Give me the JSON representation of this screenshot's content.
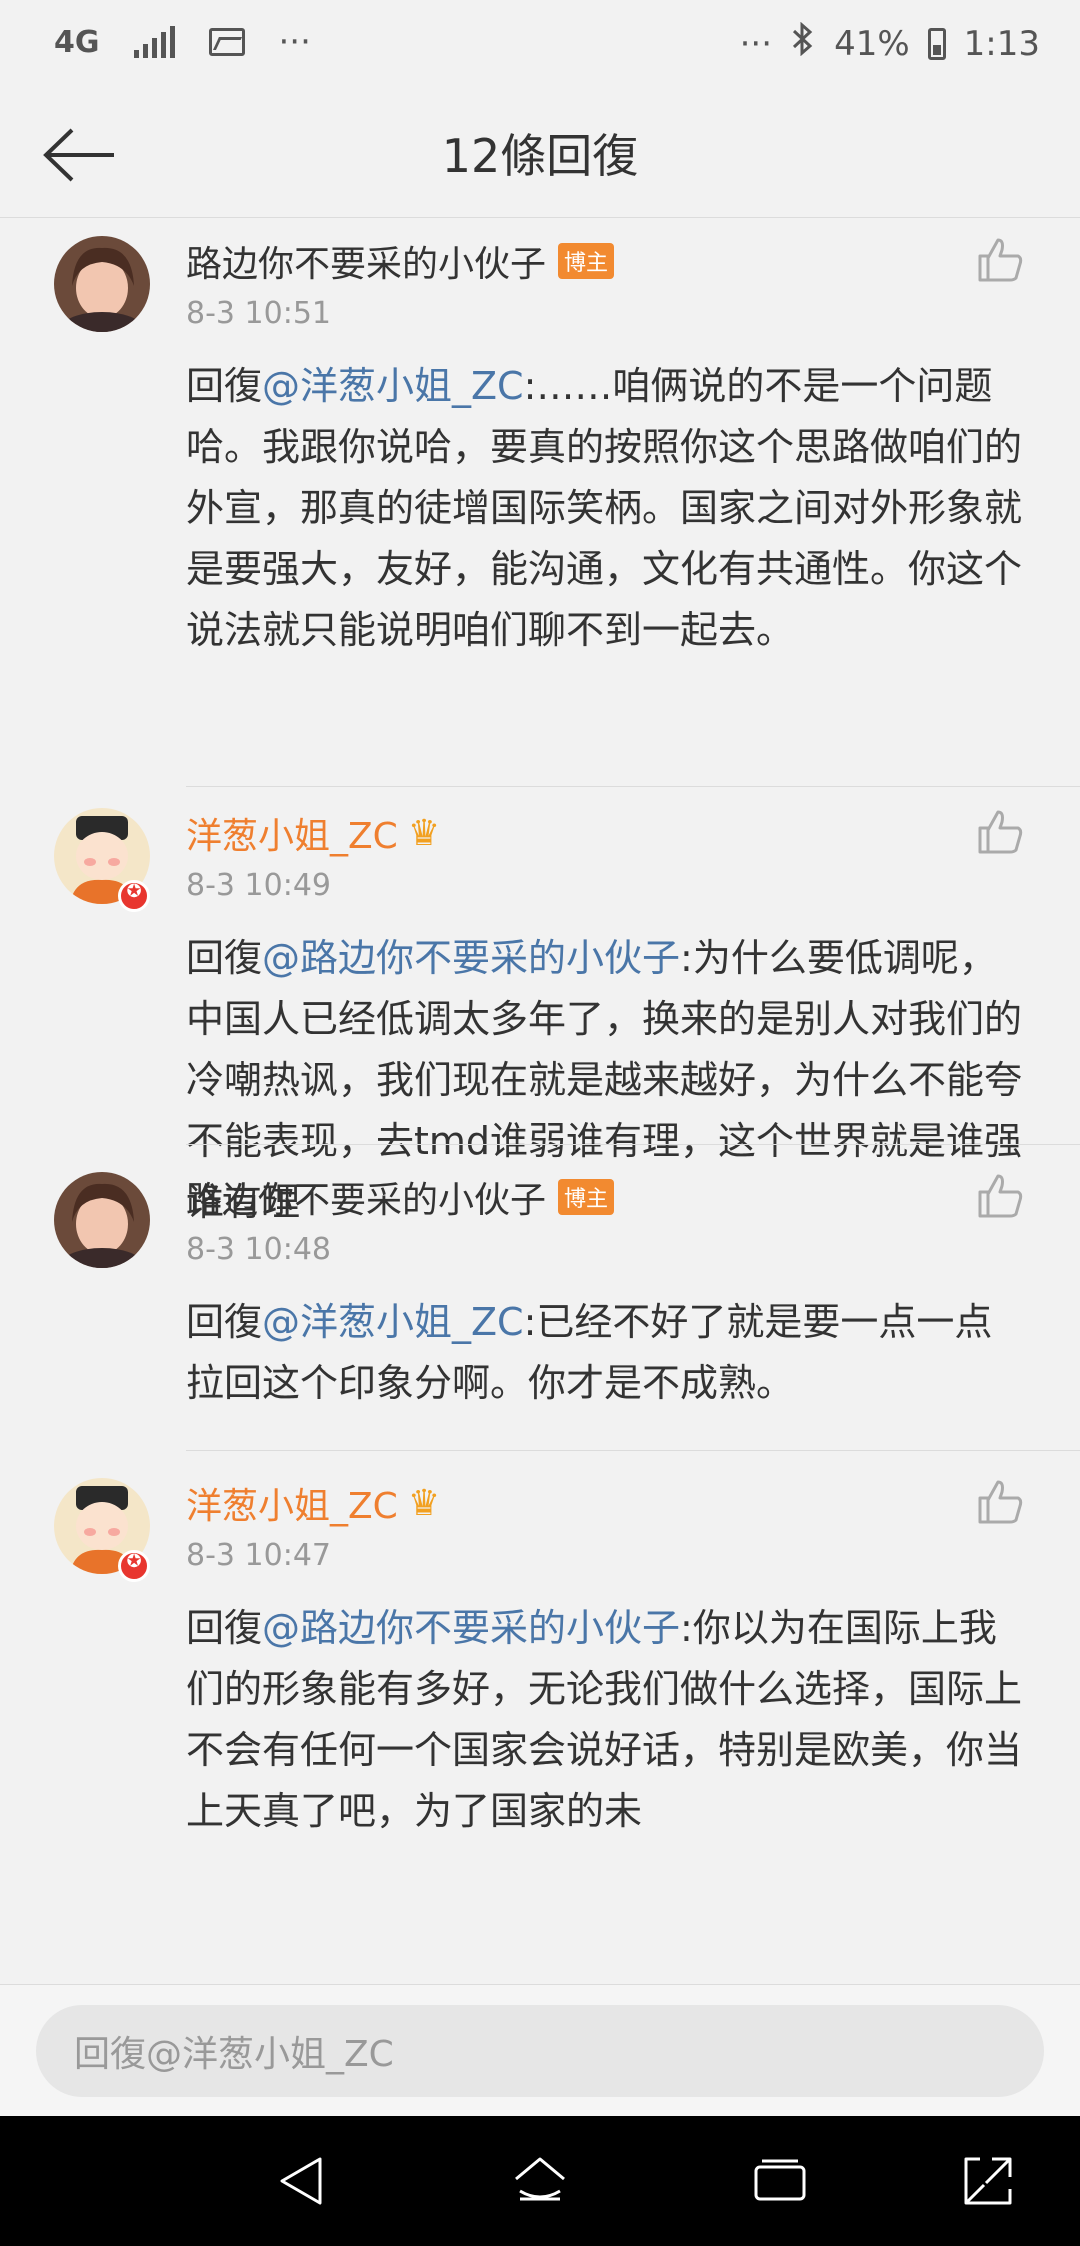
{
  "status_bar": {
    "network": "4G",
    "more_left": "···",
    "more_right": "···",
    "battery_percent": "41%",
    "time": "1:13"
  },
  "header": {
    "title": "12條回復"
  },
  "comments": [
    {
      "name": "路边你不要采的小伙子",
      "name_color": "#333333",
      "badge": "博主",
      "time": "8-3 10:51",
      "reply_prefix": "回復",
      "mention": "@洋葱小姐_ZC",
      "text": ":……咱俩说的不是一个问题哈。我跟你说哈，要真的按照你这个思路做咱们的外宣，那真的徒增国际笑柄。国家之间对外形象就是要强大，友好，能沟通，文化有共通性。你这个说法就只能说明咱们聊不到一起去。"
    },
    {
      "name": "洋葱小姐_ZC",
      "name_color": "#ef7f2f",
      "badge": "",
      "time": "8-3 10:49",
      "reply_prefix": "回復",
      "mention": "@路边你不要采的小伙子",
      "text": ":为什么要低调呢，中国人已经低调太多年了，换来的是别人对我们的冷嘲热讽，我们现在就是越来越好，为什么不能夸不能表现，去tmd谁弱谁有理，这个世界就是谁强谁有理"
    },
    {
      "name": "路边你不要采的小伙子",
      "name_color": "#333333",
      "badge": "博主",
      "time": "8-3 10:48",
      "reply_prefix": "回復",
      "mention": "@洋葱小姐_ZC",
      "text": ":已经不好了就是要一点一点拉回这个印象分啊。你才是不成熟。"
    },
    {
      "name": "洋葱小姐_ZC",
      "name_color": "#ef7f2f",
      "badge": "",
      "time": "8-3 10:47",
      "reply_prefix": "回復",
      "mention": "@路边你不要采的小伙子",
      "text": ":你以为在国际上我们的形象能有多好，无论我们做什么选择，国际上不会有任何一个国家会说好话，特别是欧美，你当上天真了吧，为了国家的未"
    }
  ],
  "reply_bar": {
    "placeholder": "回復@洋葱小姐_ZC"
  },
  "colors": {
    "mention": "#4a76a8",
    "vip_name": "#ef7f2f",
    "badge_bg": "#f28a30"
  }
}
